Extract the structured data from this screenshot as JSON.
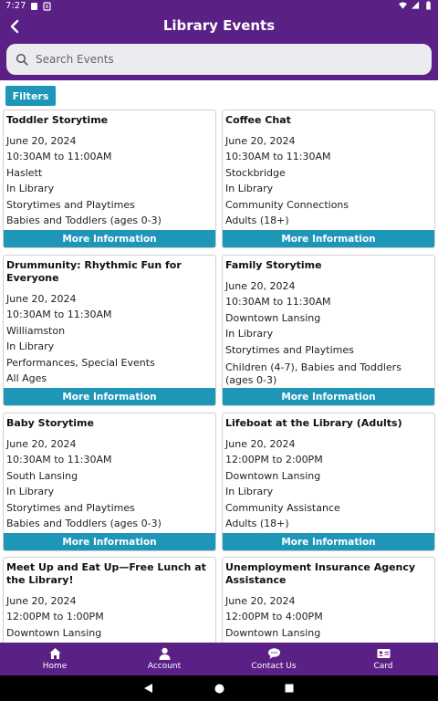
{
  "status_bar": {
    "time": "7:27"
  },
  "app_bar": {
    "title": "Library Events"
  },
  "search": {
    "placeholder": "Search Events"
  },
  "filters": {
    "label": "Filters"
  },
  "more_info_label": "More Information",
  "events": [
    {
      "title": "Toddler Storytime",
      "date": "June 20, 2024",
      "time": "10:30AM to 11:00AM",
      "branch": "Haslett",
      "location": "In Library",
      "category": "Storytimes and Playtimes",
      "audience": "Babies and Toddlers (ages 0-3)"
    },
    {
      "title": "Coffee Chat",
      "date": "June 20, 2024",
      "time": "10:30AM to 11:30AM",
      "branch": "Stockbridge",
      "location": "In Library",
      "category": "Community Connections",
      "audience": "Adults (18+)"
    },
    {
      "title": "Drummunity: Rhythmic Fun for Everyone",
      "date": "June 20, 2024",
      "time": "10:30AM to 11:30AM",
      "branch": "Williamston",
      "location": "In Library",
      "category": "Performances, Special Events",
      "audience": "All Ages"
    },
    {
      "title": "Family Storytime",
      "date": "June 20, 2024",
      "time": "10:30AM to 11:30AM",
      "branch": "Downtown Lansing",
      "location": "In Library",
      "category": "Storytimes and Playtimes",
      "audience": "Children (4-7), Babies and Toddlers (ages 0-3)"
    },
    {
      "title": "Baby Storytime",
      "date": "June 20, 2024",
      "time": "10:30AM to 11:30AM",
      "branch": "South Lansing",
      "location": "In Library",
      "category": "Storytimes and Playtimes",
      "audience": "Babies and Toddlers (ages 0-3)"
    },
    {
      "title": "Lifeboat at the Library (Adults)",
      "date": "June 20, 2024",
      "time": "12:00PM to 2:00PM",
      "branch": "Downtown Lansing",
      "location": "In Library",
      "category": "Community Assistance",
      "audience": "Adults (18+)"
    },
    {
      "title": "Meet Up and Eat Up—Free Lunch at the Library!",
      "date": "June 20, 2024",
      "time": "12:00PM to 1:00PM",
      "branch": "Downtown Lansing",
      "location": "",
      "category": "",
      "audience": ""
    },
    {
      "title": "Unemployment Insurance Agency Assistance",
      "date": "June 20, 2024",
      "time": "12:00PM to 4:00PM",
      "branch": "Downtown Lansing",
      "location": "",
      "category": "",
      "audience": ""
    }
  ],
  "bottom_nav": [
    {
      "label": "Home",
      "icon": "home-icon"
    },
    {
      "label": "Account",
      "icon": "account-icon"
    },
    {
      "label": "Contact Us",
      "icon": "chat-icon"
    },
    {
      "label": "Card",
      "icon": "card-icon"
    }
  ],
  "colors": {
    "brand": "#5a2085",
    "accent": "#1e96b8"
  }
}
